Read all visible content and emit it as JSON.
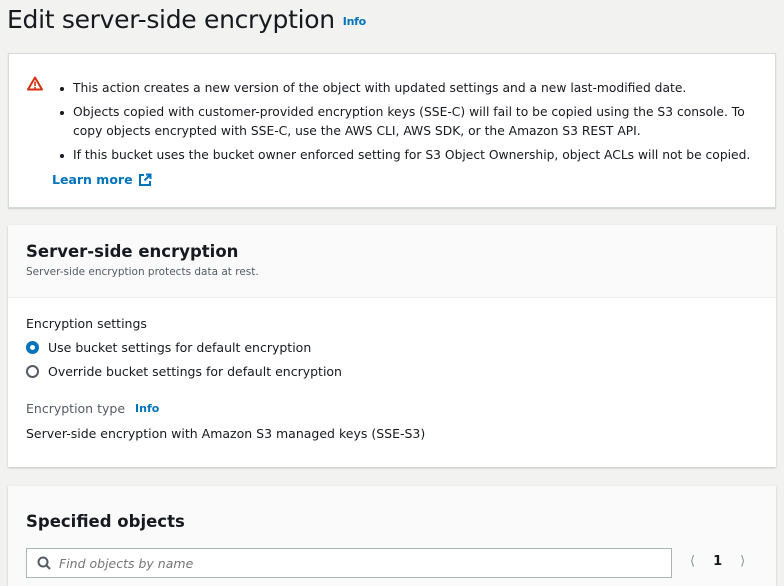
{
  "page": {
    "title": "Edit server-side encryption",
    "info": "Info"
  },
  "alert": {
    "items": [
      "This action creates a new version of the object with updated settings and a new last-modified date.",
      "Objects copied with customer-provided encryption keys (SSE-C) will fail to be copied using the S3 console. To copy objects encrypted with SSE-C, use the AWS CLI, AWS SDK, or the Amazon S3 REST API.",
      "If this bucket uses the bucket owner enforced setting for S3 Object Ownership, object ACLs will not be copied."
    ],
    "learn_more": "Learn more",
    "icon": "warning-icon",
    "color": "#d13212"
  },
  "sse": {
    "title": "Server-side encryption",
    "description": "Server-side encryption protects data at rest.",
    "settings_label": "Encryption settings",
    "options": [
      {
        "label": "Use bucket settings for default encryption",
        "selected": true
      },
      {
        "label": "Override bucket settings for default encryption",
        "selected": false
      }
    ],
    "type_label": "Encryption type",
    "type_info": "Info",
    "type_value": "Server-side encryption with Amazon S3 managed keys (SSE-S3)"
  },
  "objects": {
    "title": "Specified objects",
    "search_placeholder": "Find objects by name",
    "page": "1"
  }
}
